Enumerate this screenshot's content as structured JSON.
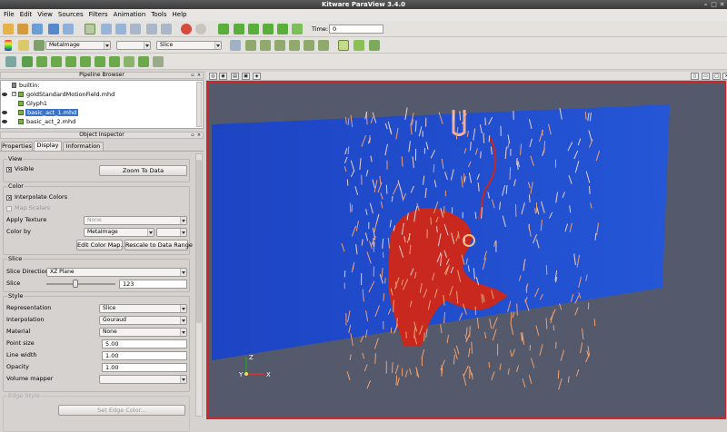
{
  "window": {
    "title": "Kitware ParaView 3.4.0"
  },
  "menu": [
    "File",
    "Edit",
    "View",
    "Sources",
    "Filters",
    "Animation",
    "Tools",
    "Help"
  ],
  "toolbar": {
    "time_label": "Time:",
    "time_value": "0",
    "array_combo": "MetaImage",
    "filter_combo": "Slice"
  },
  "pipeline": {
    "title": "Pipeline Browser",
    "items": [
      "builtin:",
      "goldStandardMotionField.mhd",
      "Glyph1",
      "basic_act_1.mhd",
      "basic_act_2.mhd"
    ]
  },
  "inspector": {
    "title": "Object Inspector",
    "tabs": [
      "Properties",
      "Display",
      "Information"
    ],
    "view": {
      "title": "View",
      "visible_label": "Visible",
      "zoom_button": "Zoom To Data"
    },
    "color": {
      "title": "Color",
      "interpolate_label": "Interpolate Colors",
      "map_scalars_label": "Map Scalars",
      "apply_texture_label": "Apply Texture",
      "apply_texture_value": "None",
      "color_by_label": "Color by",
      "color_by_value": "MetaImage",
      "edit_color_map": "Edit Color Map...",
      "rescale": "Rescale to Data Range"
    },
    "slice": {
      "title": "Slice",
      "direction_label": "Slice Direction",
      "direction_value": "XZ Plane",
      "slice_label": "Slice",
      "slice_value": "123",
      "slider_fraction": 0.42
    },
    "style": {
      "title": "Style",
      "rows": [
        {
          "label": "Representation",
          "value": "Slice",
          "kind": "combo"
        },
        {
          "label": "Interpolation",
          "value": "Gouraud",
          "kind": "combo"
        },
        {
          "label": "Material",
          "value": "None",
          "kind": "combo"
        },
        {
          "label": "Point size",
          "value": "5.00",
          "kind": "spin"
        },
        {
          "label": "Line width",
          "value": "1.00",
          "kind": "spin"
        },
        {
          "label": "Opacity",
          "value": "1.00",
          "kind": "spin"
        },
        {
          "label": "Volume mapper",
          "value": "",
          "kind": "combo"
        }
      ]
    },
    "edge": {
      "title": "Edge Style",
      "set_edge_color": "Set Edge Color..."
    }
  },
  "axes": {
    "x": "X",
    "y": "Y",
    "z": "Z"
  },
  "colors": {
    "slice_blue": "#1f48c8",
    "highlight_red": "#c8281e",
    "background": "#545a6c",
    "active_border": "#d0252a"
  }
}
